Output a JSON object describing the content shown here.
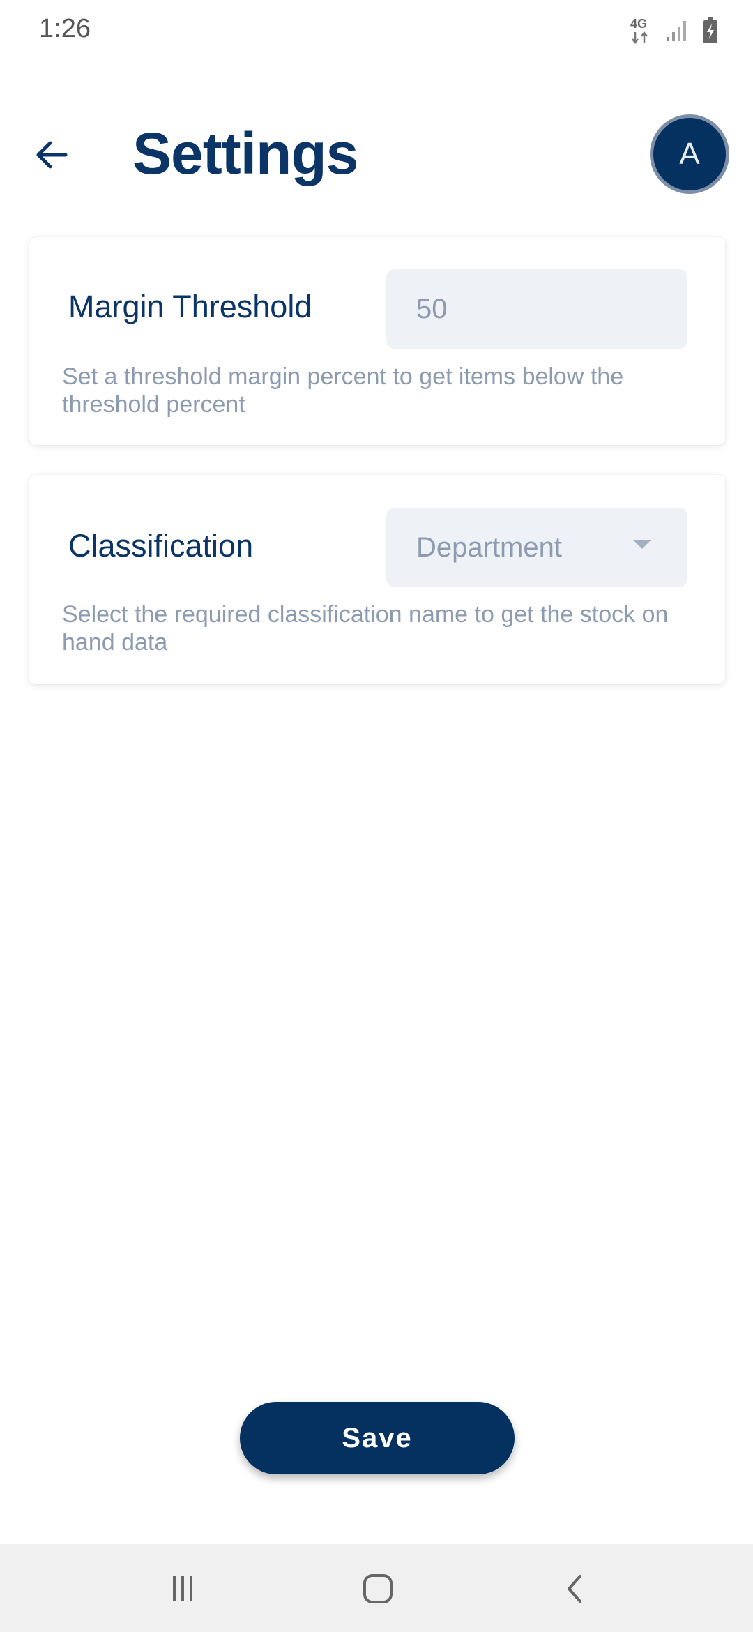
{
  "status_bar": {
    "time": "1:26",
    "network": "4G",
    "icons": [
      "network-4g-icon",
      "signal-icon",
      "battery-charging-icon"
    ]
  },
  "header": {
    "back_icon": "arrow-left-icon",
    "title": "Settings",
    "avatar_initial": "A"
  },
  "margin_threshold": {
    "label": "Margin Threshold",
    "value": "50",
    "description": "Set a threshold margin percent to get items below the threshold percent"
  },
  "classification": {
    "label": "Classification",
    "selected": "Department",
    "description": "Select the required classification name to get the stock on hand data"
  },
  "actions": {
    "save_label": "Save"
  },
  "nav_bar": {
    "icons": [
      "recent-apps-icon",
      "home-icon",
      "back-icon"
    ]
  },
  "colors": {
    "primary": "#04315f",
    "title": "#0b3566",
    "muted_text": "#8d9bb0",
    "input_bg": "#eef1f5"
  }
}
